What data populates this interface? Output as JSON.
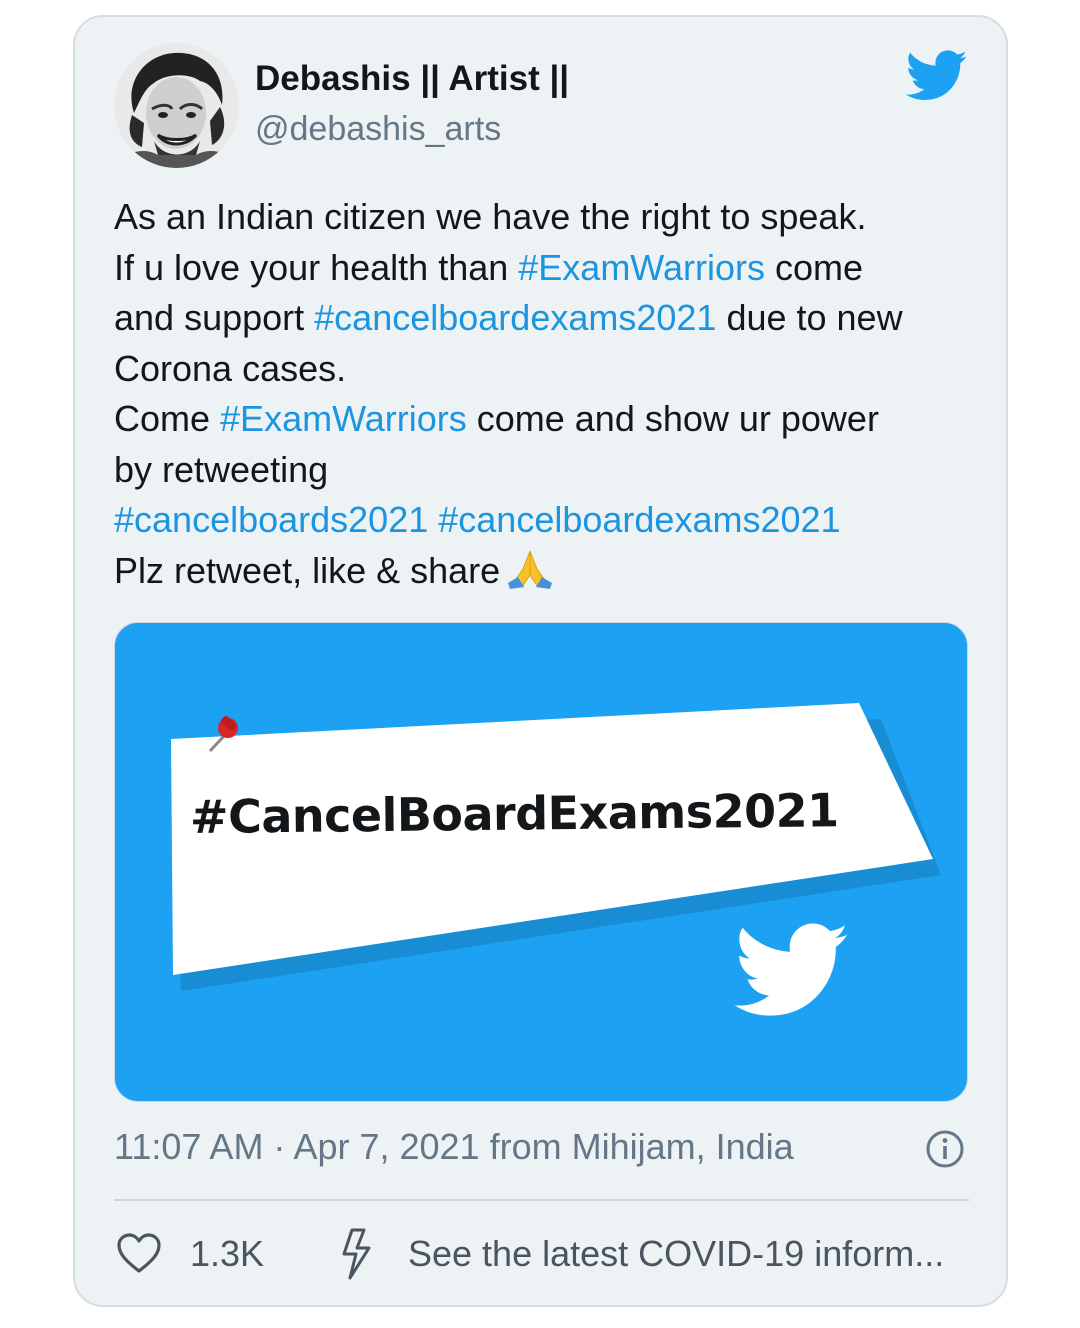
{
  "author": {
    "name": "Debashis || Artist ||",
    "handle": "@debashis_arts",
    "avatar_icon": "artist-portrait-avatar"
  },
  "tweet": {
    "line1": "As an Indian citizen we have the right to speak.",
    "line2_a": "If u love your health than ",
    "line2_tag": "#ExamWarriors",
    "line2_b": " come",
    "line3_a": "and support ",
    "line3_tag": "#cancelboardexams2021",
    "line3_b": " due to new",
    "line4": "Corona cases.",
    "line5_a": "Come ",
    "line5_tag": "#ExamWarriors",
    "line5_b": " come and show ur power",
    "line6": "by retweeting",
    "line7_tag1": "#cancelboards2021",
    "line7_tag2": "#cancelboardexams2021",
    "line8": "Plz retweet, like & share",
    "emoji": "folded-hands-emoji"
  },
  "media": {
    "text": "#CancelBoardExams2021",
    "background": "#1da1f2"
  },
  "meta": {
    "timestamp": "11:07 AM · Apr 7, 2021 from Mihijam, India"
  },
  "actions": {
    "likes": "1.3K",
    "covid_link": "See the latest COVID-19 inform..."
  },
  "colors": {
    "accent": "#1b95e0",
    "twitter_blue": "#1da1f2",
    "card_bg": "#edf2f5",
    "secondary_text": "#657786"
  }
}
